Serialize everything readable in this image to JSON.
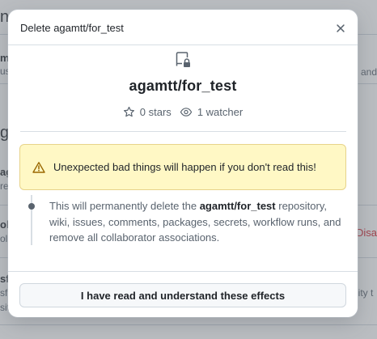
{
  "background_page": {
    "fragments": {
      "a": "ne",
      "b": "m",
      "c": "usi",
      "d": "and",
      "e": "g",
      "f": "ag",
      "g": "re",
      "h": "ol",
      "i": "ol",
      "j": "Disa",
      "k": "sf",
      "l": "sf",
      "m": "lity t",
      "n": "sit"
    }
  },
  "dialog": {
    "title": "Delete agamtt/for_test",
    "repo_name": "agamtt/for_test",
    "stars": "0 stars",
    "watchers": "1 watcher",
    "warning_text": "Unexpected bad things will happen if you don't read this!",
    "description": {
      "before": "This will permanently delete the ",
      "repo": "agamtt/for_test",
      "after": " repository, wiki, issues, comments, packages, secrets, workflow runs, and remove all collaborator associations."
    },
    "confirm_button": "I have read and understand these effects"
  },
  "icons": {
    "close": "x-icon",
    "repo": "repo-locked-icon",
    "star": "star-icon",
    "watch": "eye-icon",
    "warning": "alert-icon"
  },
  "colors": {
    "warning_bg": "#fff8c5",
    "warning_border": "#e7d38a",
    "danger": "#d1242f",
    "muted_text": "#59636e"
  }
}
